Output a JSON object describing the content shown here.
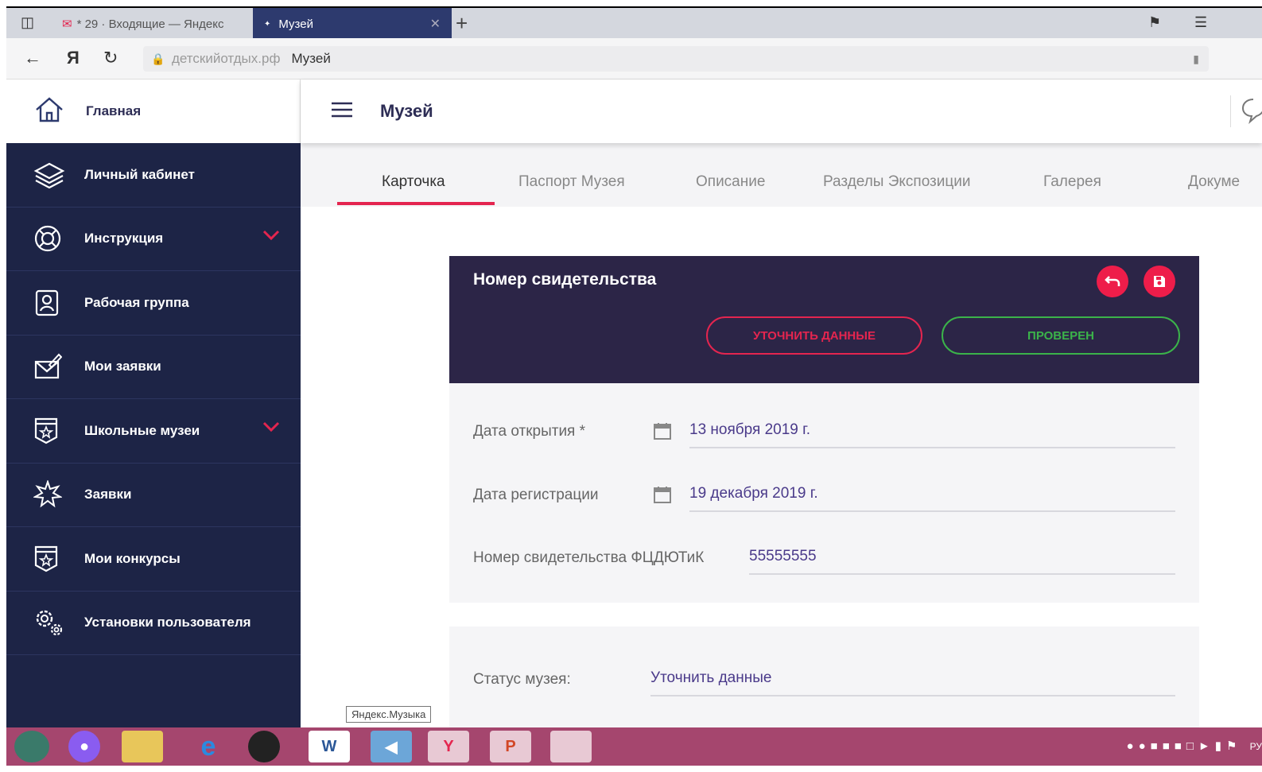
{
  "browser": {
    "tabs": [
      {
        "label": "* 29 · Входящие — Яндекс",
        "active": false
      },
      {
        "label": "Музей",
        "active": true
      }
    ],
    "address": {
      "host": "детскийотдых.рф",
      "title": "Музей"
    }
  },
  "sidebar": {
    "home_label": "Главная",
    "items": [
      {
        "label": "Личный кабинет",
        "icon": "layers-icon",
        "expandable": false
      },
      {
        "label": "Инструкция",
        "icon": "lifebuoy-icon",
        "expandable": true
      },
      {
        "label": "Рабочая группа",
        "icon": "badge-icon",
        "expandable": false
      },
      {
        "label": "Мои заявки",
        "icon": "mail-edit-icon",
        "expandable": false
      },
      {
        "label": "Школьные музеи",
        "icon": "star-shield-icon",
        "expandable": true
      },
      {
        "label": "Заявки",
        "icon": "burst-icon",
        "expandable": false
      },
      {
        "label": "Мои конкурсы",
        "icon": "star-shield-icon",
        "expandable": false
      },
      {
        "label": "Установки пользователя",
        "icon": "gears-icon",
        "expandable": false
      }
    ],
    "accent": "#e4254f"
  },
  "header": {
    "title": "Музей"
  },
  "tabs": [
    "Карточка",
    "Паспорт Музея",
    "Описание",
    "Разделы Экспозиции",
    "Галерея",
    "Докуме"
  ],
  "active_tab": "Карточка",
  "card": {
    "title": "Номер свидетельства",
    "btn_refine": "УТОЧНИТЬ ДАННЫЕ",
    "btn_checked": "ПРОВЕРЕН",
    "fields": [
      {
        "label": "Дата открытия *",
        "value": "13 ноября 2019 г."
      },
      {
        "label": "Дата регистрации",
        "value": "19 декабря 2019 г."
      },
      {
        "label": "Номер свидетельства ФЦДЮТиК",
        "value": "55555555"
      }
    ]
  },
  "status": {
    "label": "Статус музея:",
    "value": "Уточнить данные"
  },
  "tooltip": "Яндекс.Музыка",
  "tray": {
    "lang": "РУ"
  },
  "colors": {
    "sidebar_bg": "#1d2446",
    "card_head_bg": "#2c2547",
    "accent_red": "#e4254f",
    "accent_green": "#3bb34a",
    "taskbar_bg": "#a5466e"
  }
}
